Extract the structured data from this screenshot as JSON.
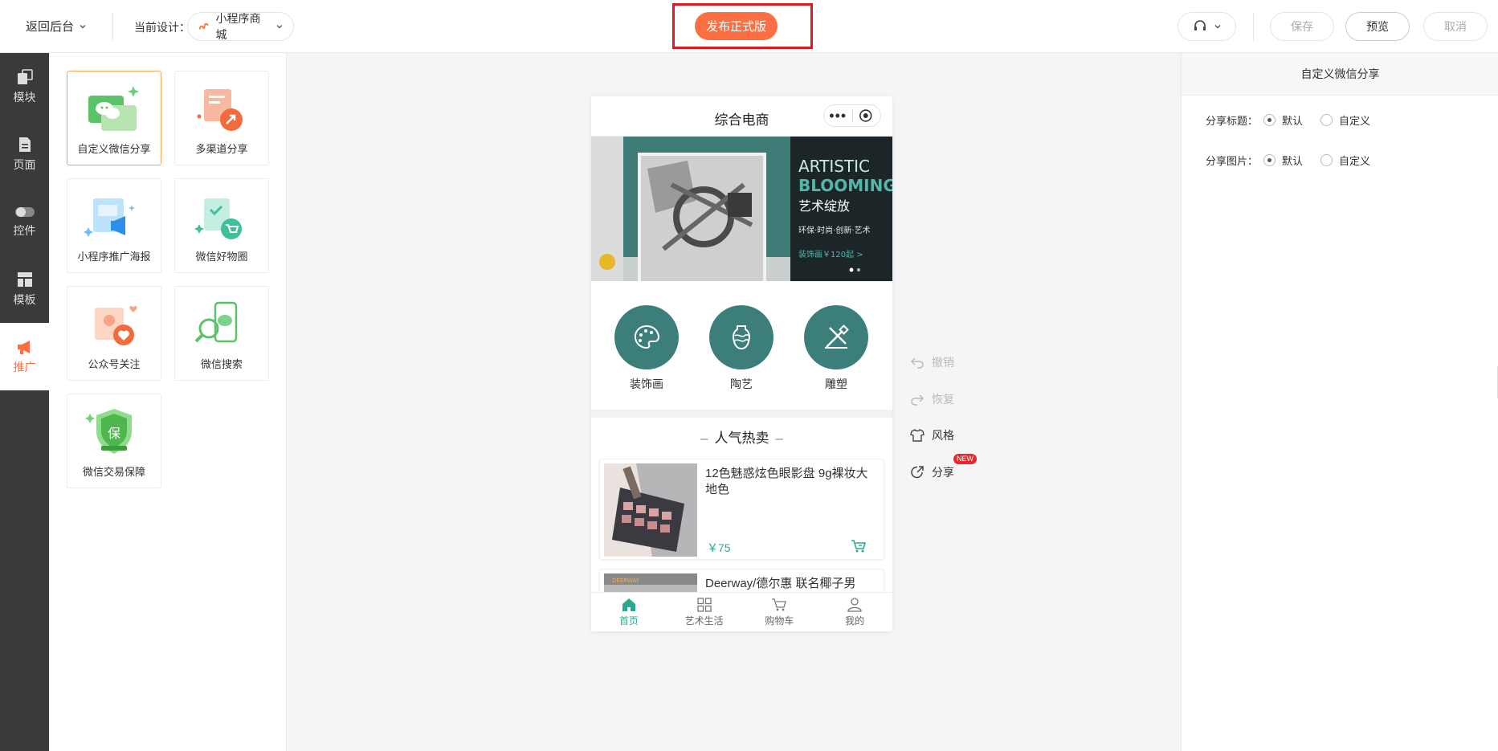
{
  "topbar": {
    "back_label": "返回后台",
    "current_design_label": "当前设计：",
    "design_name": "小程序商城",
    "publish_label": "发布正式版",
    "save_label": "保存",
    "preview_label": "预览",
    "cancel_label": "取消"
  },
  "left_nav": [
    {
      "label": "模块",
      "icon": "blocks-icon"
    },
    {
      "label": "页面",
      "icon": "page-icon"
    },
    {
      "label": "控件",
      "icon": "toggle-icon"
    },
    {
      "label": "模板",
      "icon": "template-icon"
    },
    {
      "label": "推广",
      "icon": "megaphone-icon",
      "active": true
    }
  ],
  "widgets": [
    {
      "label": "自定义微信分享",
      "selected": true
    },
    {
      "label": "多渠道分享"
    },
    {
      "label": "小程序推广海报"
    },
    {
      "label": "微信好物圈"
    },
    {
      "label": "公众号关注"
    },
    {
      "label": "微信搜索"
    },
    {
      "label": "微信交易保障"
    }
  ],
  "phone": {
    "title": "综合电商",
    "banner": {
      "line1": "ARTISTIC",
      "line2": "BLOOMING",
      "line3": "艺术绽放",
      "line4": "环保·时尚·创新·艺术",
      "line5": "装饰画￥120起 >"
    },
    "categories": [
      {
        "label": "装饰画"
      },
      {
        "label": "陶艺"
      },
      {
        "label": "雕塑"
      }
    ],
    "hot_title": "人气热卖",
    "products": [
      {
        "name": "12色魅惑炫色眼影盘 9g裸妆大地色",
        "price": "￥75"
      },
      {
        "name": "Deerway/德尔惠 联名椰子男",
        "price": ""
      }
    ],
    "tabs": [
      {
        "label": "首页",
        "active": true
      },
      {
        "label": "艺术生活"
      },
      {
        "label": "购物车"
      },
      {
        "label": "我的"
      }
    ]
  },
  "tools": {
    "undo": "撤销",
    "redo": "恢复",
    "style": "风格",
    "share": "分享",
    "new_badge": "NEW"
  },
  "right_panel": {
    "title": "自定义微信分享",
    "share_title_label": "分享标题：",
    "share_image_label": "分享图片：",
    "opt_default": "默认",
    "opt_custom": "自定义"
  },
  "colors": {
    "brand_orange": "#fc6f43",
    "teal": "#3b7e7a",
    "price_green": "#2aa98f",
    "highlight_red": "#e0191d"
  }
}
